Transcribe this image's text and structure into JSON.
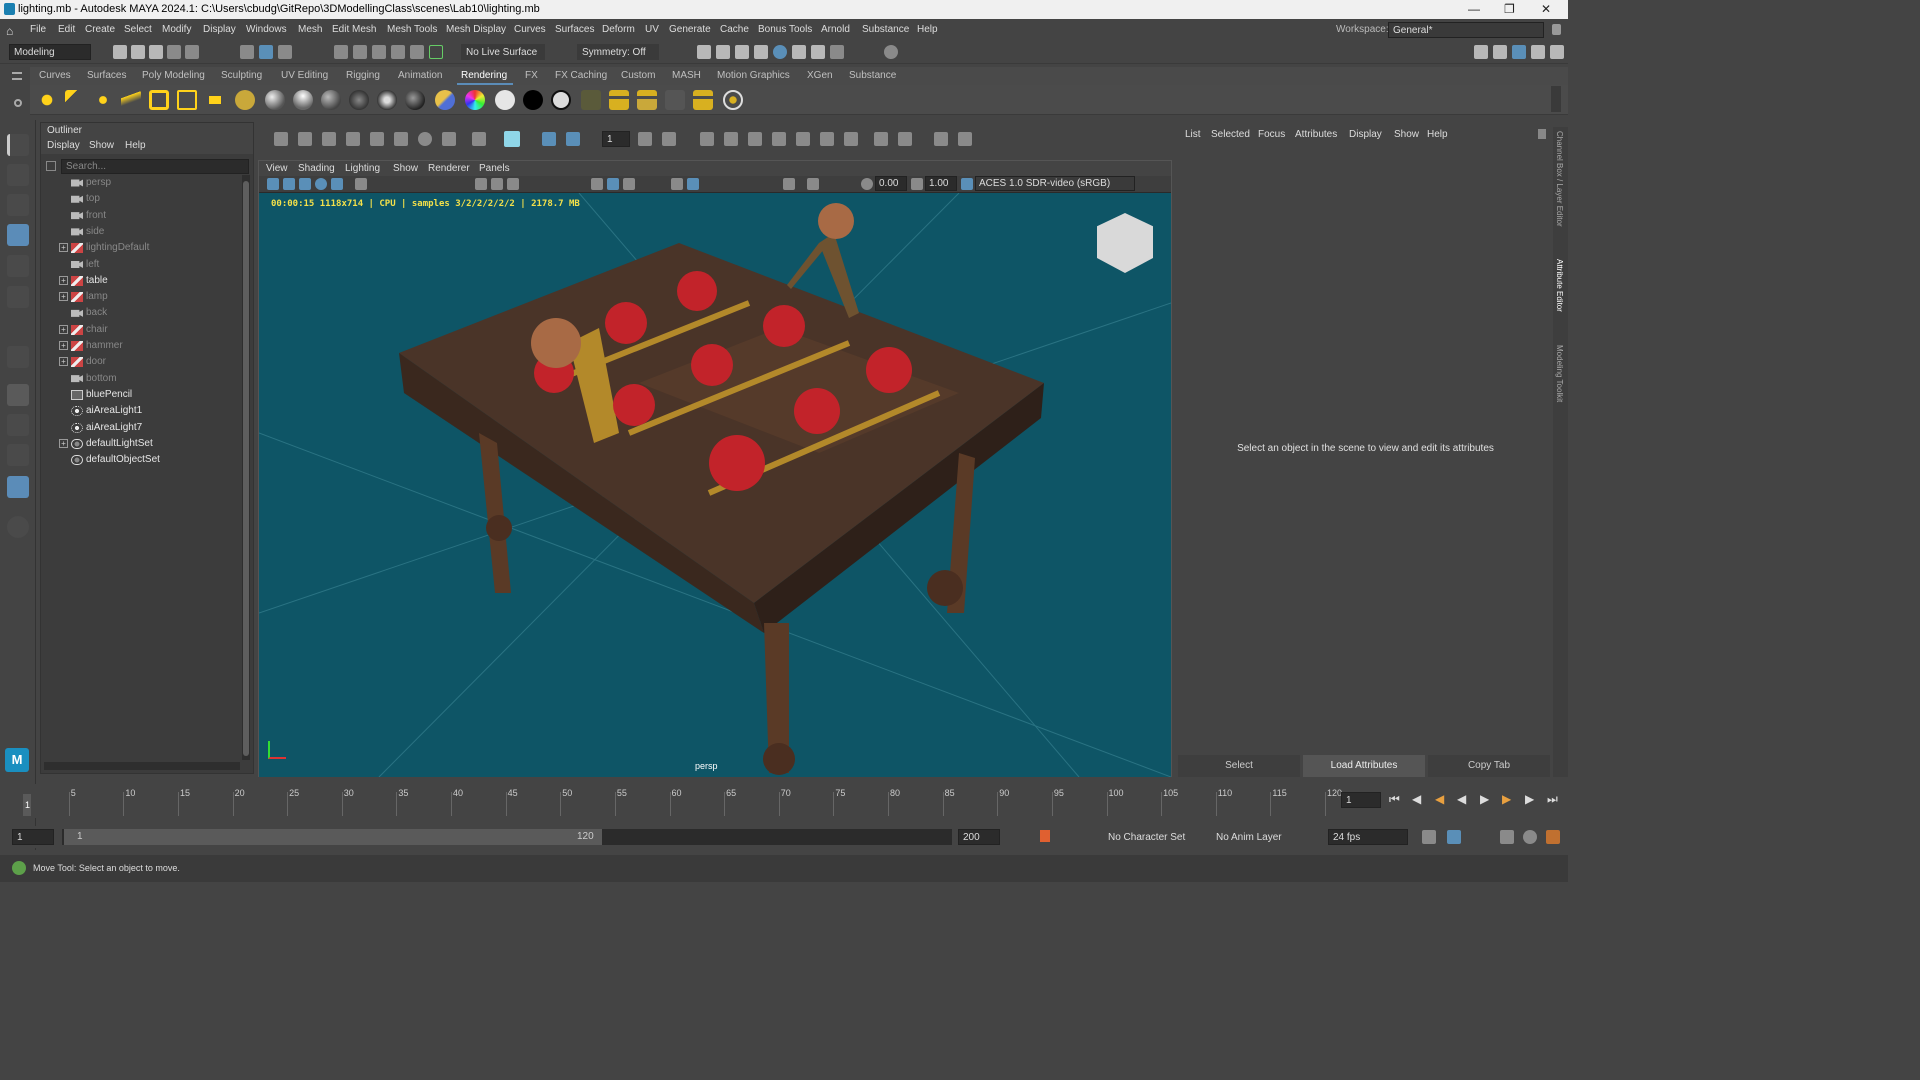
{
  "window": {
    "title": "lighting.mb - Autodesk MAYA 2024.1: C:\\Users\\cbudg\\GitRepo\\3DModellingClass\\scenes\\Lab10\\lighting.mb"
  },
  "menubar": {
    "items": [
      "File",
      "Edit",
      "Create",
      "Select",
      "Modify",
      "Display",
      "Windows",
      "Mesh",
      "Edit Mesh",
      "Mesh Tools",
      "Mesh Display",
      "Curves",
      "Surfaces",
      "Deform",
      "UV",
      "Generate",
      "Cache",
      "Bonus Tools",
      "Arnold",
      "Substance",
      "Help"
    ],
    "workspace_label": "Workspace:",
    "workspace_value": "General*"
  },
  "statusline": {
    "menuset": "Modeling",
    "live_surface": "No Live Surface",
    "symmetry": "Symmetry: Off"
  },
  "shelf": {
    "tabs": [
      "Curves",
      "Surfaces",
      "Poly Modeling",
      "Sculpting",
      "UV Editing",
      "Rigging",
      "Animation",
      "Rendering",
      "FX",
      "FX Caching",
      "Custom",
      "MASH",
      "Motion Graphics",
      "XGen",
      "Substance"
    ],
    "active_tab": "Rendering"
  },
  "outliner": {
    "title": "Outliner",
    "menu": [
      "Display",
      "Show",
      "Help"
    ],
    "search_placeholder": "Search...",
    "items": [
      {
        "label": "persp",
        "icon": "camera-icon",
        "expand": false,
        "dim": true
      },
      {
        "label": "top",
        "icon": "camera-icon",
        "expand": false,
        "dim": true
      },
      {
        "label": "front",
        "icon": "camera-icon",
        "expand": false,
        "dim": true
      },
      {
        "label": "side",
        "icon": "camera-icon",
        "expand": false,
        "dim": true
      },
      {
        "label": "lightingDefault",
        "icon": "transform-icon",
        "expand": true,
        "dim": true
      },
      {
        "label": "left",
        "icon": "camera-icon",
        "expand": false,
        "dim": true
      },
      {
        "label": "table",
        "icon": "transform-icon",
        "expand": true,
        "dim": false
      },
      {
        "label": "lamp",
        "icon": "transform-icon",
        "expand": true,
        "dim": true
      },
      {
        "label": "back",
        "icon": "camera-icon",
        "expand": false,
        "dim": true
      },
      {
        "label": "chair",
        "icon": "transform-icon",
        "expand": true,
        "dim": true
      },
      {
        "label": "hammer",
        "icon": "transform-icon",
        "expand": true,
        "dim": true
      },
      {
        "label": "door",
        "icon": "transform-icon",
        "expand": true,
        "dim": true
      },
      {
        "label": "bottom",
        "icon": "camera-icon",
        "expand": false,
        "dim": true
      },
      {
        "label": "bluePencil",
        "icon": "pencil-icon",
        "expand": false,
        "dim": false
      },
      {
        "label": "aiAreaLight1",
        "icon": "light-icon",
        "expand": false,
        "dim": false
      },
      {
        "label": "aiAreaLight7",
        "icon": "light-icon",
        "expand": false,
        "dim": false
      },
      {
        "label": "defaultLightSet",
        "icon": "set-icon",
        "expand": true,
        "dim": false
      },
      {
        "label": "defaultObjectSet",
        "icon": "set-icon",
        "expand": false,
        "dim": false
      }
    ]
  },
  "viewport": {
    "menu": [
      "View",
      "Shading",
      "Lighting",
      "Show",
      "Renderer",
      "Panels"
    ],
    "exposure": "0.00",
    "gamma": "1.00",
    "color_space": "ACES 1.0 SDR-video (sRGB)",
    "frame_field": "1",
    "hud": "00:00:15 1118x714 | CPU | samples 3/2/2/2/2/2 | 2178.7 MB",
    "camera_label": "persp",
    "background_color": "#0e5566"
  },
  "attribute_editor": {
    "menu": [
      "List",
      "Selected",
      "Focus",
      "Attributes",
      "Display",
      "Show",
      "Help"
    ],
    "message": "Select an object in the scene to view and edit its attributes",
    "buttons": [
      "Select",
      "Load Attributes",
      "Copy Tab"
    ],
    "side_tabs": [
      "Channel Box / Layer Editor",
      "Attribute Editor",
      "Modeling Toolkit"
    ]
  },
  "timeline": {
    "ticks": [
      "5",
      "10",
      "15",
      "20",
      "25",
      "30",
      "35",
      "40",
      "45",
      "50",
      "55",
      "60",
      "65",
      "70",
      "75",
      "80",
      "85",
      "90",
      "95",
      "100",
      "105",
      "110",
      "115",
      "120"
    ],
    "current_frame": "1",
    "current_frame_field": "1"
  },
  "range": {
    "start": "1",
    "inner_start": "1",
    "inner_end": "120",
    "end": "200",
    "character_set": "No Character Set",
    "anim_layer": "No Anim Layer",
    "fps": "24 fps"
  },
  "help_line": {
    "text": "Move Tool: Select an object to move."
  }
}
